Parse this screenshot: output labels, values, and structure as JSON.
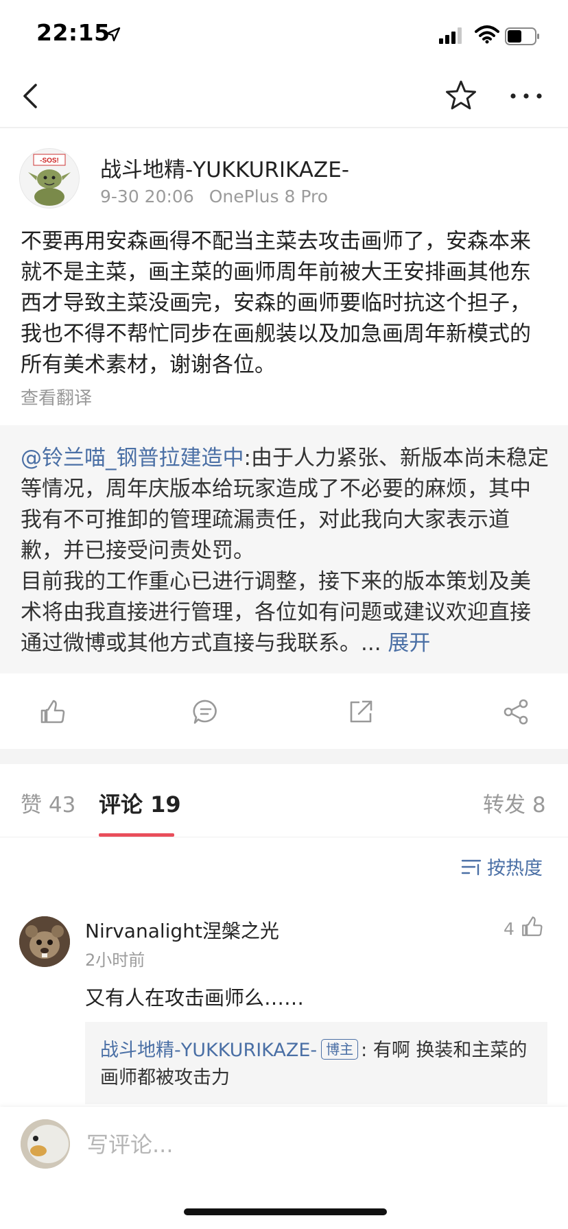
{
  "status_bar": {
    "time": "22:15"
  },
  "post": {
    "author": "战斗地精-YUKKURIKAZE-",
    "date": "9-30 20:06",
    "device": "OnePlus 8 Pro",
    "avatar_text": "-SOS!",
    "text": "不要再用安森画得不配当主菜去攻击画师了，安森本来就不是主菜，画主菜的画师周年前被大王安排画其他东西才导致主菜没画完，安森的画师要临时抗这个担子，我也不得不帮忙同步在画舰装以及加急画周年新模式的所有美术素材，谢谢各位。",
    "translate_label": "查看翻译"
  },
  "repost": {
    "mention": "@铃兰喵_钢普拉建造中",
    "text": ":由于人力紧张、新版本尚未稳定等情况，周年庆版本给玩家造成了不必要的麻烦，其中我有不可推卸的管理疏漏责任，对此我向大家表示道歉，并已接受问责处罚。\n目前我的工作重心已进行调整，接下来的版本策划及美术将由我直接进行管理，各位如有问题或建议欢迎直接通过微博或其他方式直接与我联系。... ",
    "expand_label": "展开"
  },
  "tabs": {
    "likes": "赞 43",
    "comments": "评论 19",
    "reposts": "转发 8"
  },
  "sort_label": "按热度",
  "comment": {
    "name": "Nirvanalight涅槃之光",
    "time": "2小时前",
    "likes": "4",
    "text": "又有人在攻击画师么……",
    "reply": {
      "name": "战斗地精-YUKKURIKAZE-",
      "badge": "博主",
      "text": ": 有啊  换装和主菜的画师都被攻击力"
    }
  },
  "input": {
    "placeholder": "写评论..."
  },
  "colors": {
    "link": "#4a6fa5",
    "tab_accent": "#e94e5b",
    "muted": "#9b9b9b"
  }
}
